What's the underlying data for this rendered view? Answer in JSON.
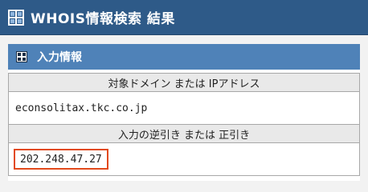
{
  "header": {
    "title": "WHOIS情報検索 結果",
    "icon": "grid-icon"
  },
  "section": {
    "label": "入力情報",
    "icon": "grid-icon"
  },
  "table": {
    "target_header": "対象ドメイン または IPアドレス",
    "target_value": "econsolitax.tkc.co.jp",
    "lookup_header": "入力の逆引き または 正引き",
    "lookup_value": "202.248.47.27"
  },
  "colors": {
    "header_bg": "#2e5a88",
    "section_bg": "#4f82b8",
    "highlight_border": "#e2491b"
  }
}
